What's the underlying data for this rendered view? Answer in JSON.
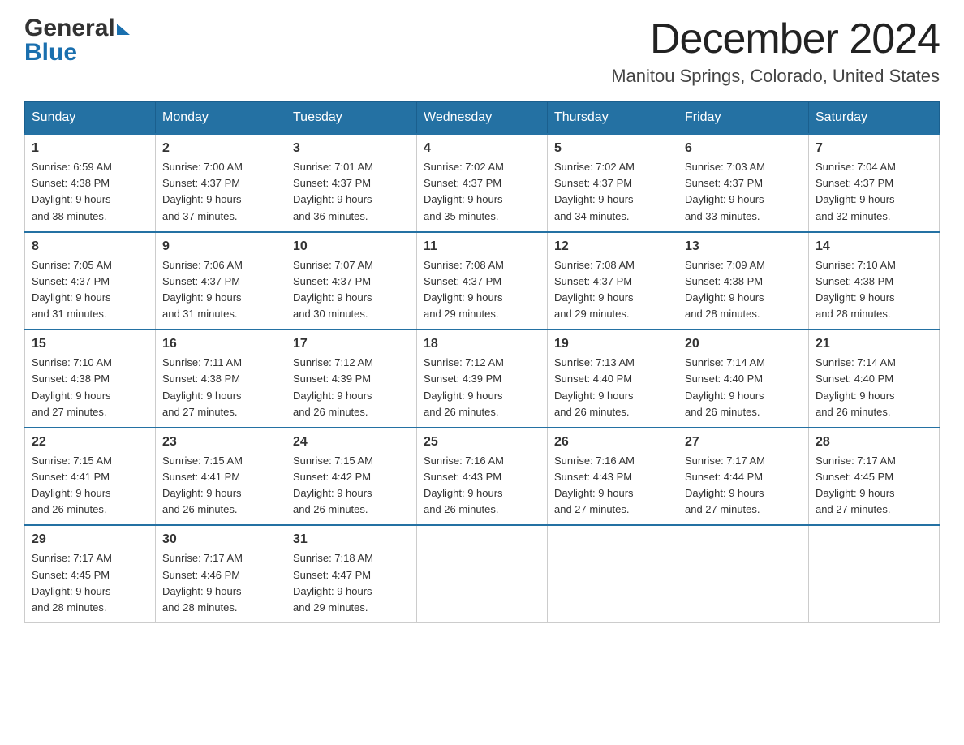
{
  "header": {
    "logo_general": "General",
    "logo_blue": "Blue",
    "month_title": "December 2024",
    "location": "Manitou Springs, Colorado, United States"
  },
  "weekdays": [
    "Sunday",
    "Monday",
    "Tuesday",
    "Wednesday",
    "Thursday",
    "Friday",
    "Saturday"
  ],
  "weeks": [
    [
      {
        "day": "1",
        "sunrise": "6:59 AM",
        "sunset": "4:38 PM",
        "daylight": "9 hours and 38 minutes."
      },
      {
        "day": "2",
        "sunrise": "7:00 AM",
        "sunset": "4:37 PM",
        "daylight": "9 hours and 37 minutes."
      },
      {
        "day": "3",
        "sunrise": "7:01 AM",
        "sunset": "4:37 PM",
        "daylight": "9 hours and 36 minutes."
      },
      {
        "day": "4",
        "sunrise": "7:02 AM",
        "sunset": "4:37 PM",
        "daylight": "9 hours and 35 minutes."
      },
      {
        "day": "5",
        "sunrise": "7:02 AM",
        "sunset": "4:37 PM",
        "daylight": "9 hours and 34 minutes."
      },
      {
        "day": "6",
        "sunrise": "7:03 AM",
        "sunset": "4:37 PM",
        "daylight": "9 hours and 33 minutes."
      },
      {
        "day": "7",
        "sunrise": "7:04 AM",
        "sunset": "4:37 PM",
        "daylight": "9 hours and 32 minutes."
      }
    ],
    [
      {
        "day": "8",
        "sunrise": "7:05 AM",
        "sunset": "4:37 PM",
        "daylight": "9 hours and 31 minutes."
      },
      {
        "day": "9",
        "sunrise": "7:06 AM",
        "sunset": "4:37 PM",
        "daylight": "9 hours and 31 minutes."
      },
      {
        "day": "10",
        "sunrise": "7:07 AM",
        "sunset": "4:37 PM",
        "daylight": "9 hours and 30 minutes."
      },
      {
        "day": "11",
        "sunrise": "7:08 AM",
        "sunset": "4:37 PM",
        "daylight": "9 hours and 29 minutes."
      },
      {
        "day": "12",
        "sunrise": "7:08 AM",
        "sunset": "4:37 PM",
        "daylight": "9 hours and 29 minutes."
      },
      {
        "day": "13",
        "sunrise": "7:09 AM",
        "sunset": "4:38 PM",
        "daylight": "9 hours and 28 minutes."
      },
      {
        "day": "14",
        "sunrise": "7:10 AM",
        "sunset": "4:38 PM",
        "daylight": "9 hours and 28 minutes."
      }
    ],
    [
      {
        "day": "15",
        "sunrise": "7:10 AM",
        "sunset": "4:38 PM",
        "daylight": "9 hours and 27 minutes."
      },
      {
        "day": "16",
        "sunrise": "7:11 AM",
        "sunset": "4:38 PM",
        "daylight": "9 hours and 27 minutes."
      },
      {
        "day": "17",
        "sunrise": "7:12 AM",
        "sunset": "4:39 PM",
        "daylight": "9 hours and 26 minutes."
      },
      {
        "day": "18",
        "sunrise": "7:12 AM",
        "sunset": "4:39 PM",
        "daylight": "9 hours and 26 minutes."
      },
      {
        "day": "19",
        "sunrise": "7:13 AM",
        "sunset": "4:40 PM",
        "daylight": "9 hours and 26 minutes."
      },
      {
        "day": "20",
        "sunrise": "7:14 AM",
        "sunset": "4:40 PM",
        "daylight": "9 hours and 26 minutes."
      },
      {
        "day": "21",
        "sunrise": "7:14 AM",
        "sunset": "4:40 PM",
        "daylight": "9 hours and 26 minutes."
      }
    ],
    [
      {
        "day": "22",
        "sunrise": "7:15 AM",
        "sunset": "4:41 PM",
        "daylight": "9 hours and 26 minutes."
      },
      {
        "day": "23",
        "sunrise": "7:15 AM",
        "sunset": "4:41 PM",
        "daylight": "9 hours and 26 minutes."
      },
      {
        "day": "24",
        "sunrise": "7:15 AM",
        "sunset": "4:42 PM",
        "daylight": "9 hours and 26 minutes."
      },
      {
        "day": "25",
        "sunrise": "7:16 AM",
        "sunset": "4:43 PM",
        "daylight": "9 hours and 26 minutes."
      },
      {
        "day": "26",
        "sunrise": "7:16 AM",
        "sunset": "4:43 PM",
        "daylight": "9 hours and 27 minutes."
      },
      {
        "day": "27",
        "sunrise": "7:17 AM",
        "sunset": "4:44 PM",
        "daylight": "9 hours and 27 minutes."
      },
      {
        "day": "28",
        "sunrise": "7:17 AM",
        "sunset": "4:45 PM",
        "daylight": "9 hours and 27 minutes."
      }
    ],
    [
      {
        "day": "29",
        "sunrise": "7:17 AM",
        "sunset": "4:45 PM",
        "daylight": "9 hours and 28 minutes."
      },
      {
        "day": "30",
        "sunrise": "7:17 AM",
        "sunset": "4:46 PM",
        "daylight": "9 hours and 28 minutes."
      },
      {
        "day": "31",
        "sunrise": "7:18 AM",
        "sunset": "4:47 PM",
        "daylight": "9 hours and 29 minutes."
      },
      null,
      null,
      null,
      null
    ]
  ]
}
